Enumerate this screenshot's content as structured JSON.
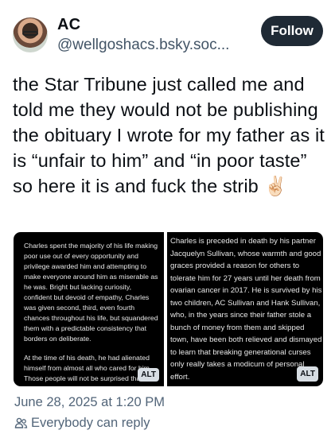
{
  "author": {
    "display_name": "AC",
    "handle": "@wellgoshacs.bsky.soc..."
  },
  "follow_label": "Follow",
  "post": {
    "text": "the Star Tribune just called me and told me they would not be publishing the obituary I wrote for my father as it is “unfair to him” and “in poor taste” so here it is and fuck the strib ✌🏻"
  },
  "images": [
    {
      "paragraphs": [
        "Charles spent the majority of his life making poor use out of every opportunity and privilege awarded him and attempting to make everyone around him as miserable as he was. Bright but lacking curiosity, confident but devoid of empathy, Charles was given second, third, even fourth chances throughout his life, but squandered them with a predictable consistency that borders on deliberate.",
        "At the time of his death, he had alienated himself from almost all who cared for him. Those people will not be surprised that"
      ],
      "alt_label": "ALT"
    },
    {
      "paragraphs": [
        "Charles is preceded in death by his partner Jacquelyn Sullivan, whose warmth and good graces provided a reason for others to tolerate him for 27 years until her death from ovarian cancer in 2017. He is survived by his two children, AC Sullivan and Hank Sullivan, who, in the years since their father stole a bunch of money from them and skipped town, have been both relieved and dismayed to learn that breaking generational curses only really takes a modicum of personal effort."
      ],
      "alt_label": "ALT"
    }
  ],
  "timestamp": "June 28, 2025 at 1:20 PM",
  "reply_setting": "Everybody can reply",
  "icons": {
    "reply_setting": "people-icon"
  }
}
